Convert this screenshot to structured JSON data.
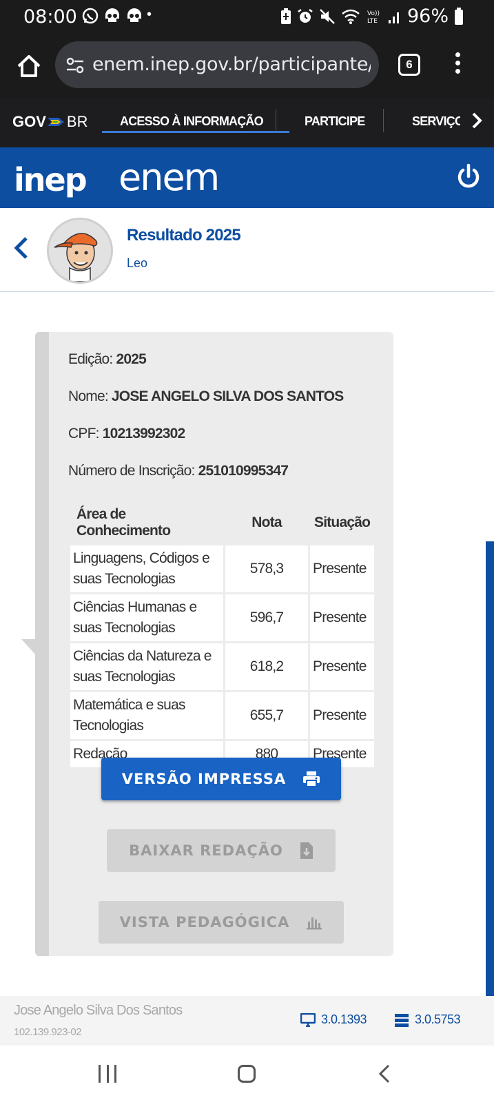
{
  "status_bar": {
    "time": "08:00",
    "dot": "•",
    "battery": "96%",
    "icons": [
      "whatsapp-icon",
      "skull-icon",
      "skull-icon",
      "battery-saver-icon",
      "alarm-icon",
      "mute-icon",
      "wifi-icon",
      "volte-icon",
      "signal-icon",
      "battery-icon"
    ]
  },
  "browser": {
    "url": "enem.inep.gov.br/participante/#!",
    "tab_count": "6"
  },
  "gov_bar": {
    "logo_gov": "GOV",
    "logo_br": "BR",
    "nav": [
      "ACESSO À INFORMAÇÃO",
      "PARTICIPE",
      "SERVIÇOS"
    ]
  },
  "header": {
    "inep_logo": "inep",
    "enem_logo": "enem"
  },
  "profile": {
    "title": "Resultado 2025",
    "subtitle": "Leo"
  },
  "result": {
    "edicao_label": "Edição:",
    "edicao_value": "2025",
    "nome_label": "Nome:",
    "nome_value": "JOSE ANGELO SILVA DOS SANTOS",
    "cpf_label": "CPF:",
    "cpf_value": "10213992302",
    "inscricao_label": "Número de Inscrição:",
    "inscricao_value": "251010995347",
    "table_headers": [
      "Área de Conhecimento",
      "Nota",
      "Situação"
    ],
    "rows": [
      {
        "area": "Linguagens, Códigos e suas Tecnologias",
        "nota": "578,3",
        "situacao": "Presente"
      },
      {
        "area": "Ciências Humanas e suas Tecnologias",
        "nota": "596,7",
        "situacao": "Presente"
      },
      {
        "area": "Ciências da Natureza e suas Tecnologias",
        "nota": "618,2",
        "situacao": "Presente"
      },
      {
        "area": "Matemática e suas Tecnologias",
        "nota": "655,7",
        "situacao": "Presente"
      },
      {
        "area": "Redação",
        "nota": "880",
        "situacao": "Presente"
      }
    ],
    "btn_print": "VERSÃO IMPRESSA",
    "btn_redacao": "BAIXAR REDAÇÃO",
    "btn_pedagogica": "VISTA PEDAGÓGICA"
  },
  "footer": {
    "name": "Jose Angelo Silva Dos Santos",
    "doc": "102.139.923-02",
    "front_version": "3.0.1393",
    "back_version": "3.0.5753"
  },
  "colors": {
    "primary": "#0d4ea1",
    "button": "#1863c4",
    "dark_bar": "#1b1b1b"
  }
}
